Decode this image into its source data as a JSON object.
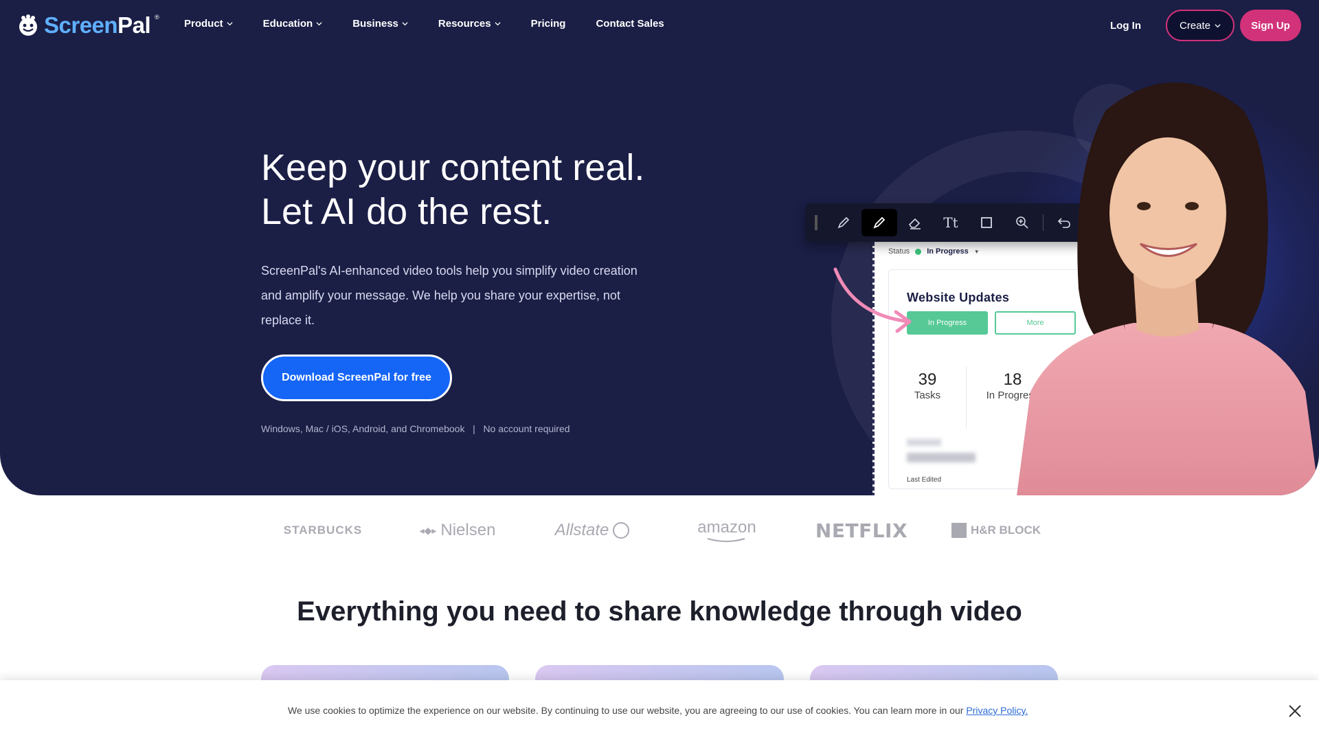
{
  "nav": {
    "logo_text_1": "Screen",
    "logo_text_2": "Pal",
    "logo_reg": "®",
    "items": [
      {
        "label": "Product",
        "dropdown": true
      },
      {
        "label": "Education",
        "dropdown": true
      },
      {
        "label": "Business",
        "dropdown": true
      },
      {
        "label": "Resources",
        "dropdown": true
      },
      {
        "label": "Pricing",
        "dropdown": false
      },
      {
        "label": "Contact Sales",
        "dropdown": false
      }
    ],
    "login": "Log In",
    "create": "Create",
    "signup": "Sign Up"
  },
  "hero": {
    "headline_line1": "Keep your content real.",
    "headline_line2": "Let AI do the rest.",
    "subcopy": "ScreenPal's AI-enhanced video tools help you simplify video creation and amplify your message. We help you share your expertise, not replace it.",
    "cta": "Download ScreenPal for free",
    "platforms": "Windows, Mac / iOS, Android, and Chromebook   |   No account required"
  },
  "mockup": {
    "toolbar_icons": [
      "pen-icon",
      "highlighter-icon",
      "eraser-icon",
      "text-icon",
      "rectangle-icon",
      "zoom-icon",
      "undo-icon",
      "redo-icon"
    ],
    "status_label": "Status",
    "status_value": "In Progress",
    "card_title": "Website Updates",
    "pill_primary": "In Progress",
    "pill_secondary": "More",
    "stat1_num": "39",
    "stat1_label": "Tasks",
    "stat2_num": "18",
    "stat2_label": "In Progress",
    "last_edited": "Last Edited"
  },
  "logos": [
    "STARBUCKS",
    "Nielsen",
    "Allstate",
    "amazon",
    "NETFLIX",
    "H&R BLOCK"
  ],
  "section": {
    "title": "Everything you need to share knowledge through video"
  },
  "cookie": {
    "text": "We use cookies to optimize the experience on our website. By continuing to use our website, you are agreeing to our use of cookies. You can learn more in our ",
    "link": "Privacy Policy."
  },
  "colors": {
    "hero_bg": "#1b1e45",
    "accent_pink": "#d2327a",
    "cta_blue": "#1565f6",
    "logo_blue": "#5fb0ff",
    "status_green": "#56c996"
  }
}
